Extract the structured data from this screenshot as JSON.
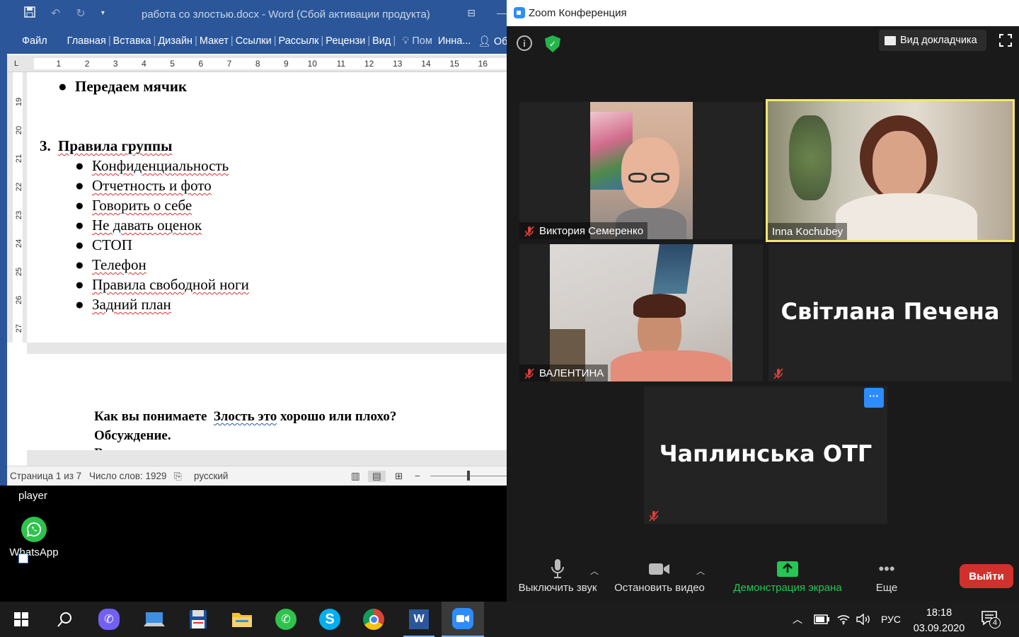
{
  "word": {
    "title": "работа со злостью.docx - Word (Сбой активации продукта)",
    "tabs": [
      "Главная",
      "Вставка",
      "Дизайн",
      "Макет",
      "Ссылки",
      "Рассылк",
      "Рецензи",
      "Вид"
    ],
    "file_tab": "Файл",
    "tell_me": "Пом",
    "user": "Инна...",
    "share": "Общ",
    "ruler_numbers": [
      "1",
      "2",
      "3",
      "4",
      "5",
      "6",
      "7",
      "8",
      "9",
      "10",
      "11",
      "12",
      "13",
      "14",
      "15",
      "16"
    ],
    "vruler_numbers": [
      "19",
      "20",
      "21",
      "22",
      "23",
      "24",
      "25",
      "26",
      "27"
    ],
    "page1": {
      "top_bullet": "Передаем мячик",
      "section_number": "3.",
      "section_title": "Правила группы",
      "bullets": [
        "Конфиденциальность",
        "Отчетность и фото",
        "Говорить о себе",
        "Не давать оценок",
        "СТОП",
        "Телефон",
        "Правила свободной ноги",
        "Задний план"
      ]
    },
    "page2": {
      "line1_a": "Как вы понимаете",
      "line1_b": "Злость это",
      "line1_c": "хорошо или плохо?",
      "line2": "Обсуждение.",
      "line3": "В"
    },
    "status": {
      "page": "Страница 1 из 7",
      "words": "Число слов: 1929",
      "language": "русский"
    }
  },
  "desktop": {
    "player_label": "player",
    "whatsapp_label": "WhatsApp"
  },
  "zoom": {
    "title": "Zoom Конференция",
    "speaker_view": "Вид докладчика",
    "participants": [
      {
        "name": "Виктория Семеренко",
        "muted": true
      },
      {
        "name": "Inna Kochubey",
        "muted": false
      },
      {
        "name": "ВАЛЕНТИНА",
        "muted": true
      },
      {
        "name": "Світлана Печена",
        "muted": true
      },
      {
        "name": "Чаплинська ОТГ",
        "muted": true
      }
    ],
    "more_dots": "···",
    "toolbar": {
      "mute": "Выключить звук",
      "video": "Остановить видео",
      "share": "Демонстрация экрана",
      "more": "Еще",
      "leave": "Выйти"
    }
  },
  "taskbar": {
    "language": "РУС",
    "time": "18:18",
    "date": "03.09.2020",
    "notifications": "4",
    "apps": [
      "start",
      "search",
      "viber",
      "computer",
      "floppy",
      "explorer",
      "whatsapp",
      "skype",
      "chrome",
      "word",
      "zoom"
    ]
  },
  "colors": {
    "word_blue": "#2b579a",
    "zoom_bg": "#1a1a1a",
    "active_speaker": "#f0e96c",
    "share_green": "#25c653",
    "leave_red": "#d0312d",
    "zoom_blue": "#2d8cff"
  }
}
